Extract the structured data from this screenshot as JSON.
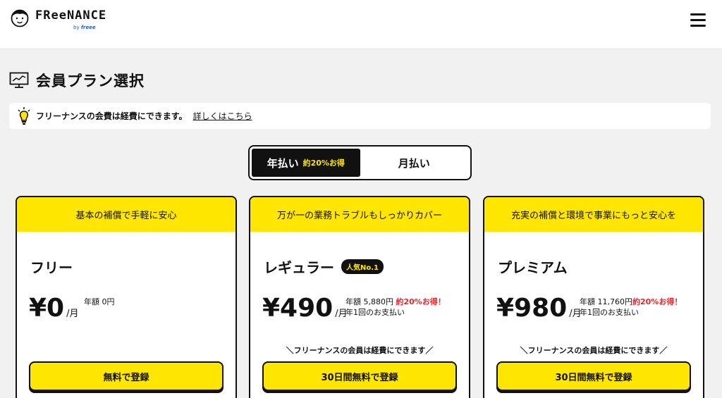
{
  "header": {
    "logo_text": "FReeNANCE",
    "logo_by": "by",
    "logo_brand": "freee"
  },
  "page": {
    "title": "会員プラン選択"
  },
  "notice": {
    "text": "フリーナンスの会費は経費にできます。",
    "link": "詳しくはこちら"
  },
  "billing_toggle": {
    "annual_label": "年払い",
    "annual_discount": "約20%お得",
    "monthly_label": "月払い",
    "selected": "annual"
  },
  "plans": [
    {
      "tagline": "基本の補償で手軽に安心",
      "name": "フリー",
      "price": "¥0",
      "per": "/月",
      "note_line1": "年額 0円",
      "cta": "無料で登録"
    },
    {
      "tagline": "万が一の業務トラブルもしっかりカバー",
      "name": "レギュラー",
      "badge": "人気No.1",
      "price": "¥490",
      "per": "/月",
      "note_line1": "年額 5,880円",
      "note_deal": "約20%お得！",
      "note_line2": "年1回のお支払い",
      "expense_note": "＼フリーナンスの会員は経費にできます／",
      "cta": "30日間無料で登録"
    },
    {
      "tagline": "充実の補償と環境で事業にもっと安心を",
      "name": "プレミアム",
      "price": "¥980",
      "per": "/月",
      "note_line1": "年額 11,760円",
      "note_deal": "約20%お得！",
      "note_line2": "年1回のお支払い",
      "expense_note": "＼フリーナンスの会員は経費にできます／",
      "cta": "30日間無料で登録"
    }
  ],
  "colors": {
    "accent_yellow": "#ffe600",
    "deal_red": "#e8242a",
    "ink": "#111111",
    "background": "#f1f1f1"
  },
  "icons": {
    "logo": "smiling-face-logo",
    "menu": "hamburger-menu-icon",
    "title": "monitor-chart-icon",
    "notice": "lightbulb-icon"
  }
}
